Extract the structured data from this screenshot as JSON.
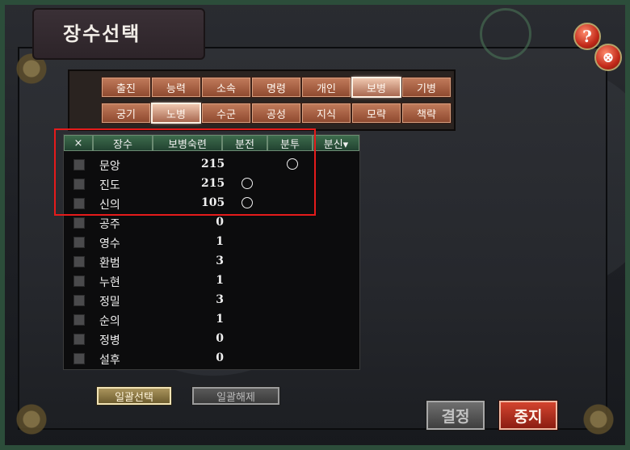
{
  "window": {
    "title": "장수선택",
    "help_label": "?",
    "close_label": "⊗"
  },
  "filter_tabs": [
    {
      "label": "출진",
      "active": false
    },
    {
      "label": "능력",
      "active": false
    },
    {
      "label": "소속",
      "active": false
    },
    {
      "label": "명령",
      "active": false
    },
    {
      "label": "개인",
      "active": false
    },
    {
      "label": "보병",
      "active": true
    },
    {
      "label": "기병",
      "active": false
    },
    {
      "label": "궁기",
      "active": false
    },
    {
      "label": "노병",
      "active": true
    },
    {
      "label": "수군",
      "active": false
    },
    {
      "label": "공성",
      "active": false
    },
    {
      "label": "지식",
      "active": false
    },
    {
      "label": "모략",
      "active": false
    },
    {
      "label": "책략",
      "active": false
    }
  ],
  "table": {
    "headers": [
      "×",
      "장수",
      "보병숙련",
      "분전",
      "분투",
      "분신▾"
    ],
    "rows": [
      {
        "name": "문앙",
        "skill": "215",
        "bunjeon": false,
        "buntu": true
      },
      {
        "name": "진도",
        "skill": "215",
        "bunjeon": true,
        "buntu": false
      },
      {
        "name": "신의",
        "skill": "105",
        "bunjeon": true,
        "buntu": false
      },
      {
        "name": "공주",
        "skill": "0",
        "bunjeon": false,
        "buntu": false
      },
      {
        "name": "영수",
        "skill": "1",
        "bunjeon": false,
        "buntu": false
      },
      {
        "name": "환범",
        "skill": "3",
        "bunjeon": false,
        "buntu": false
      },
      {
        "name": "누현",
        "skill": "1",
        "bunjeon": false,
        "buntu": false
      },
      {
        "name": "정밀",
        "skill": "3",
        "bunjeon": false,
        "buntu": false
      },
      {
        "name": "순의",
        "skill": "1",
        "bunjeon": false,
        "buntu": false
      },
      {
        "name": "정병",
        "skill": "0",
        "bunjeon": false,
        "buntu": false
      },
      {
        "name": "설후",
        "skill": "0",
        "bunjeon": false,
        "buntu": false
      }
    ]
  },
  "buttons": {
    "select_all": "일괄선택",
    "deselect_all": "일괄해제",
    "confirm": "결정",
    "cancel": "중지"
  },
  "colors": {
    "highlight": "#e51b1b",
    "tab_active": "#f0c8b0",
    "tab_normal": "#c07a5a",
    "header_green": "#3d6b4c"
  }
}
